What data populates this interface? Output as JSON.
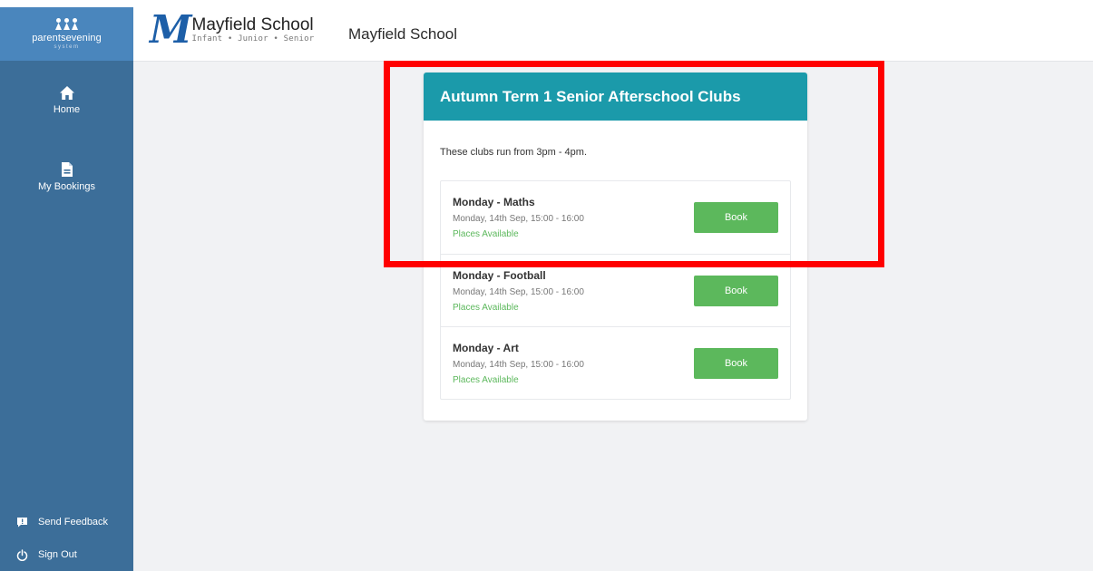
{
  "sidebar": {
    "brand_name": "parentsevening",
    "brand_sub": "system",
    "nav": [
      {
        "label": "Home",
        "icon": "home-icon"
      },
      {
        "label": "My Bookings",
        "icon": "document-icon"
      }
    ],
    "bottom": [
      {
        "label": "Send Feedback",
        "icon": "feedback-icon"
      },
      {
        "label": "Sign Out",
        "icon": "power-icon"
      }
    ]
  },
  "header": {
    "logo_title": "Mayfield School",
    "logo_tagline": "Infant • Junior • Senior",
    "school_name": "Mayfield School"
  },
  "card": {
    "title": "Autumn Term 1 Senior Afterschool Clubs",
    "description": "These clubs run from 3pm - 4pm.",
    "book_label": "Book",
    "clubs": [
      {
        "name": "Monday - Maths",
        "time": "Monday, 14th Sep, 15:00 - 16:00",
        "status": "Places Available"
      },
      {
        "name": "Monday - Football",
        "time": "Monday, 14th Sep, 15:00 - 16:00",
        "status": "Places Available"
      },
      {
        "name": "Monday - Art",
        "time": "Monday, 14th Sep, 15:00 - 16:00",
        "status": "Places Available"
      }
    ]
  },
  "colors": {
    "sidebar": "#3c6e99",
    "brand": "#4a86bd",
    "card_header": "#1b9aaa",
    "book_button": "#5cb85c",
    "highlight": "#ff0000"
  }
}
